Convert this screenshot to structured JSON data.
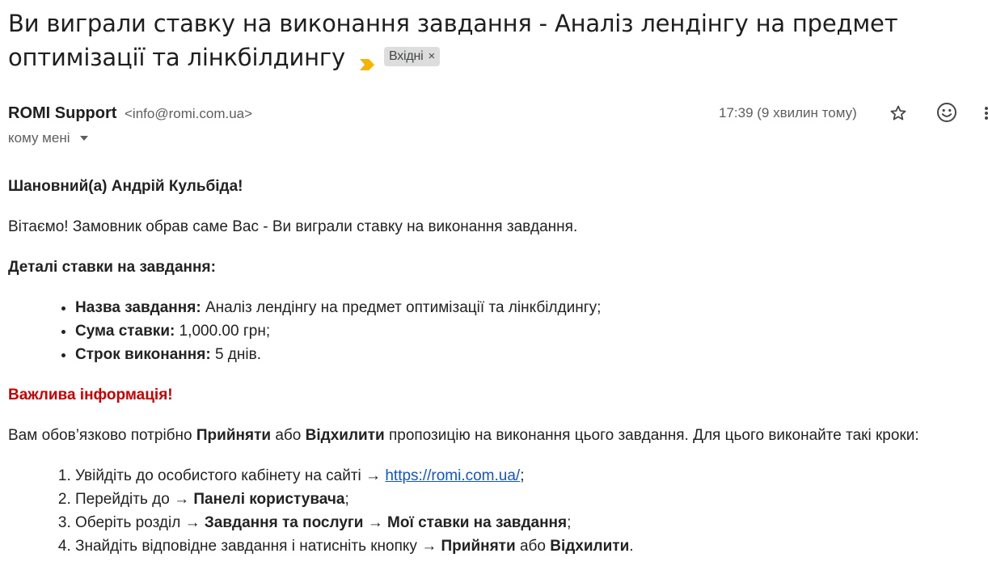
{
  "subject": {
    "title": "Ви виграли ставку на виконання завдання - Аналіз лендінгу на предмет оптимізації та лінкбілдингу",
    "label": "Вхідні",
    "label_remove": "×"
  },
  "header": {
    "sender_name": "ROMI Support",
    "sender_email": "<info@romi.com.ua>",
    "to": "кому мені",
    "time": "17:39 (9 хвилин тому)"
  },
  "body": {
    "greeting": "Шановний(а) Андрій Кульбіда!",
    "intro": "Вітаємо! Замовник обрав саме Вас - Ви виграли ставку на виконання завдання.",
    "details_title": "Деталі ставки на завдання:",
    "details": [
      {
        "label": "Назва завдання:",
        "value": " Аналіз лендінгу на предмет оптимізації та лінкбілдингу;"
      },
      {
        "label": "Сума ставки:",
        "value": " 1,000.00 грн;"
      },
      {
        "label": "Строк виконання:",
        "value": " 5 днів."
      }
    ],
    "important": "Важлива інформація!",
    "instructions": {
      "part1": "Вам обов’язково потрібно ",
      "accept": "Прийняти",
      "or": " або ",
      "decline": "Відхилити",
      "part2": " пропозицію на виконання цього завдання. Для цього виконайте такі кроки:"
    },
    "steps": {
      "s1_text": "Увійдіть до особистого кабінету на сайті → ",
      "s1_link": "https://romi.com.ua/",
      "s1_end": ";",
      "s2_text": "Перейдіть до → ",
      "s2_bold": "Панелі користувача",
      "s2_end": ";",
      "s3_text": "Оберіть розділ → ",
      "s3_bold": "Завдання та послуги → Мої ставки на завдання",
      "s3_end": ";",
      "s4_text": "Знайдіть відповідне завдання і натисніть кнопку → ",
      "s4_bold1": "Прийняти",
      "s4_or": " або ",
      "s4_bold2": "Відхилити",
      "s4_end": "."
    }
  },
  "colors": {
    "important": "#cc0000",
    "link": "#1155cc",
    "importance_marker": "#f4b400",
    "chip_bg": "#dddddd"
  },
  "icons": {
    "importance": "importance-marker-icon",
    "star": "star-icon",
    "emoji": "emoji-reaction-icon",
    "more": "more-vert-icon"
  }
}
